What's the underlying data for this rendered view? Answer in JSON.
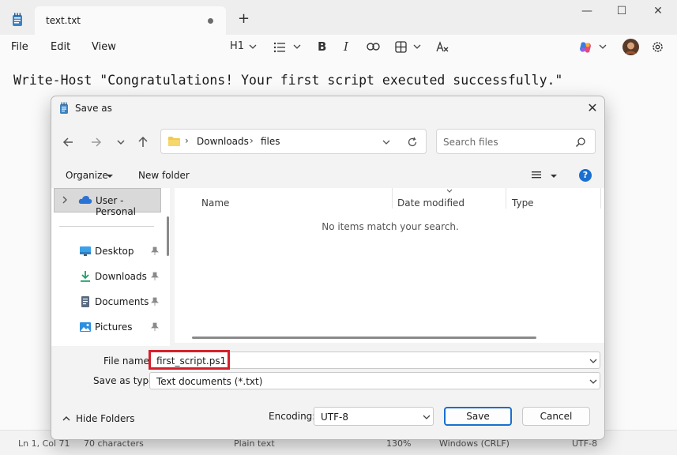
{
  "notepad": {
    "tab_title": "text.txt",
    "new_tab": "+",
    "menu": {
      "file": "File",
      "edit": "Edit",
      "view": "View"
    },
    "toolbar": {
      "heading": "H1"
    },
    "editor_text": "Write-Host \"Congratulations! Your first script executed successfully.\"",
    "status": {
      "position": "Ln 1, Col 71",
      "chars": "70 characters",
      "format": "Plain text",
      "zoom": "130%",
      "line_ending": "Windows (CRLF)",
      "encoding": "UTF-8"
    }
  },
  "dialog": {
    "title": "Save as",
    "address": {
      "part1": "Downloads",
      "part2": "files"
    },
    "search_placeholder": "Search files",
    "commands": {
      "organize": "Organize",
      "new_folder": "New folder",
      "help": "?"
    },
    "nav": {
      "selected": "User - Personal",
      "items": [
        {
          "label": "Desktop"
        },
        {
          "label": "Downloads"
        },
        {
          "label": "Documents"
        },
        {
          "label": "Pictures"
        }
      ]
    },
    "columns": {
      "name": "Name",
      "date": "Date modified",
      "type": "Type"
    },
    "empty_message": "No items match your search.",
    "file_name_label": "File name:",
    "file_name_value": "first_script.ps1",
    "save_type_label": "Save as type:",
    "save_type_value": "Text documents (*.txt)",
    "hide_folders": "Hide Folders",
    "encoding_label": "Encoding:",
    "encoding_value": "UTF-8",
    "save_button": "Save",
    "cancel_button": "Cancel"
  },
  "colors": {
    "accent": "#1a6fd0",
    "highlight_box": "#d5202b"
  }
}
